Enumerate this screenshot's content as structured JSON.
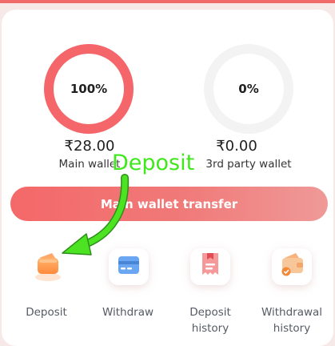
{
  "wallets": {
    "main": {
      "percent": "100%",
      "amount": "₹28.00",
      "label": "Main wallet"
    },
    "third_party": {
      "percent": "0%",
      "amount": "₹0.00",
      "label": "3rd party wallet"
    }
  },
  "transfer_button": {
    "label": "Main wallet transfer"
  },
  "actions": [
    {
      "label": "Deposit",
      "icon": "wallet-icon"
    },
    {
      "label": "Withdraw",
      "icon": "card-icon"
    },
    {
      "label": "Deposit history",
      "icon": "receipt-icon"
    },
    {
      "label": "Withdrawal history",
      "icon": "wallet-check-icon"
    }
  ],
  "annotation": {
    "text": "Deposit"
  },
  "colors": {
    "accent": "#f4666a",
    "annotation": "#3ee81a",
    "ring_empty": "#f3f3f3"
  }
}
